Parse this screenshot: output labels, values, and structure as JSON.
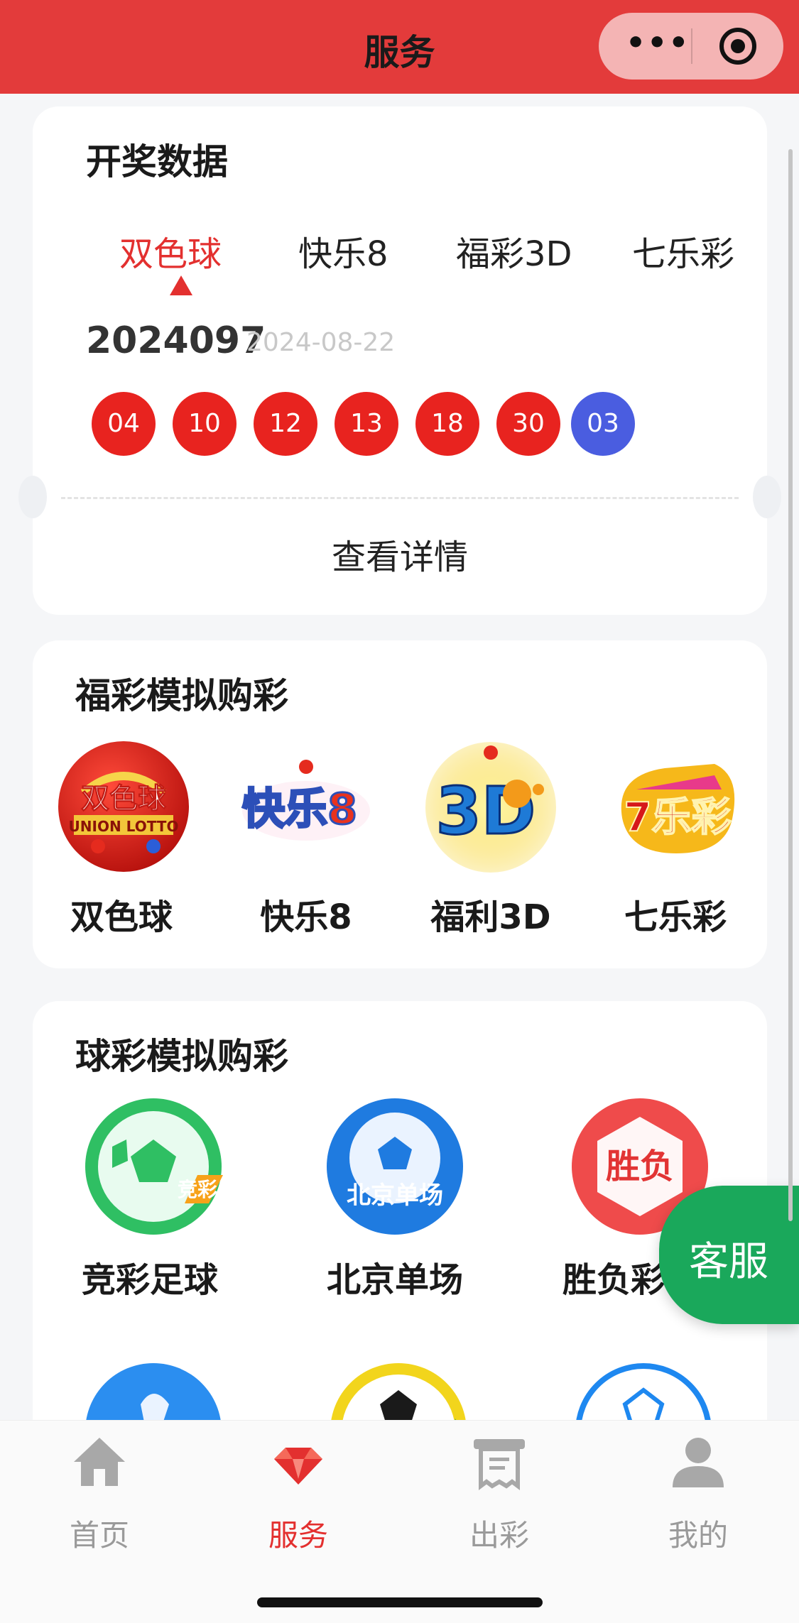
{
  "header": {
    "title": "服务"
  },
  "draw": {
    "title": "开奖数据",
    "tabs": [
      "双色球",
      "快乐8",
      "福彩3D",
      "七乐彩"
    ],
    "issue": "2024097",
    "date": "2024-08-22",
    "red_balls": [
      "04",
      "10",
      "12",
      "13",
      "18",
      "30"
    ],
    "blue_ball": "03",
    "detail_link": "查看详情"
  },
  "welfare": {
    "title": "福彩模拟购彩",
    "items": [
      {
        "label": "双色球",
        "logo_text": "双色球",
        "logo_text2": "UNION LOTTO",
        "icon": "double-color-ball-logo"
      },
      {
        "label": "快乐8",
        "logo_text": "快乐8",
        "icon": "happy-8-logo"
      },
      {
        "label": "福利3D",
        "logo_text": "3D",
        "icon": "welfare-3d-logo"
      },
      {
        "label": "七乐彩",
        "logo_text": "7乐彩",
        "icon": "seven-lottery-logo"
      }
    ]
  },
  "sports": {
    "title": "球彩模拟购彩",
    "items": [
      {
        "label": "竞彩足球",
        "badge": "竞彩",
        "icon": "jingcai-football-logo"
      },
      {
        "label": "北京单场",
        "badge": "北京单场",
        "icon": "beijing-single-logo"
      },
      {
        "label": "胜负彩",
        "badge": "胜负",
        "icon": "win-lose-logo"
      }
    ]
  },
  "service_button": "客服",
  "tabbar": [
    {
      "label": "首页",
      "icon": "home-icon"
    },
    {
      "label": "服务",
      "icon": "diamond-icon"
    },
    {
      "label": "出彩",
      "icon": "ticket-icon"
    },
    {
      "label": "我的",
      "icon": "user-icon"
    }
  ],
  "colors": {
    "brand_red": "#e33b3b",
    "red_ball": "#e8231f",
    "blue_ball": "#4a5de0",
    "service_green": "#1aa85b"
  }
}
